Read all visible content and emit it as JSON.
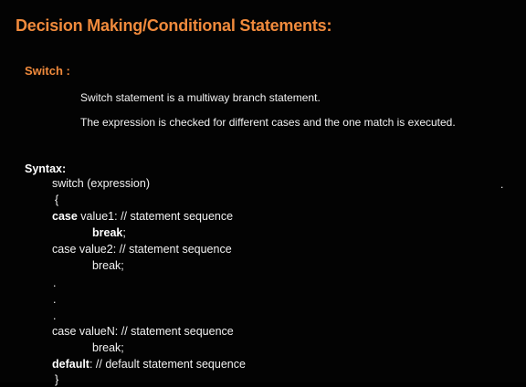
{
  "title": "Decision Making/Conditional Statements:",
  "switch_section": {
    "heading": "Switch :",
    "lines": [
      "Switch statement is a multiway branch statement.",
      "The expression is checked for different cases and the one match is executed."
    ]
  },
  "syntax": {
    "heading": "Syntax:",
    "side_dot": ".",
    "lines": {
      "switch_line": "switch (expression)",
      "open_brace": "{",
      "case1_kw": "case",
      "case1_rest": " value1: // statement sequence",
      "break1_kw": "break",
      "break1_rest": ";",
      "case2": "case value2: // statement sequence",
      "break2": "break;",
      "dot1": ".",
      "dot2": ".",
      "dot3": ".",
      "caseN": "case valueN: // statement sequence",
      "breakN": "break;",
      "default_kw": "default",
      "default_rest": ": // default statement sequence",
      "close_brace": "}"
    }
  },
  "colors": {
    "background": "#030303",
    "accent": "#f08a3c",
    "text": "#f2f2f2"
  }
}
